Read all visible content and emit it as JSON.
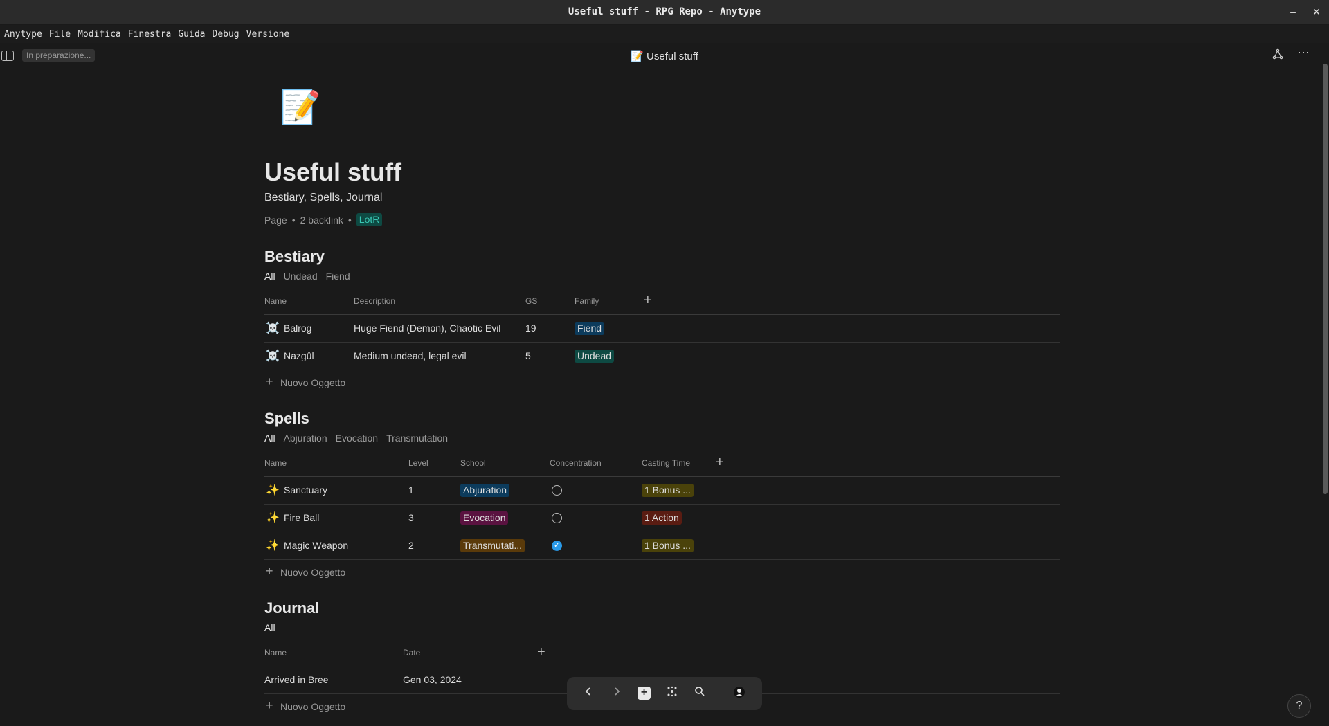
{
  "window": {
    "title": "Useful stuff - RPG Repo - Anytype"
  },
  "menu": [
    "Anytype",
    "File",
    "Modifica",
    "Finestra",
    "Guida",
    "Debug",
    "Versione"
  ],
  "header": {
    "sync_status": "In preparazione...",
    "title": "📝 Useful stuff"
  },
  "page": {
    "emoji": "📝",
    "title": "Useful stuff",
    "description": "Bestiary, Spells, Journal",
    "type": "Page",
    "backlinks": "2 backlink",
    "tag": "LotR"
  },
  "bestiary": {
    "title": "Bestiary",
    "views": [
      "All",
      "Undead",
      "Fiend"
    ],
    "columns": [
      "Name",
      "Description",
      "GS",
      "Family"
    ],
    "rows": [
      {
        "icon": "☠️",
        "name": "Balrog",
        "description": "Huge Fiend (Demon), Chaotic Evil",
        "gs": "19",
        "family": "Fiend"
      },
      {
        "icon": "☠️",
        "name": "Nazgûl",
        "description": "Medium undead, legal evil",
        "gs": "5",
        "family": "Undead"
      }
    ],
    "new_label": "Nuovo Oggetto"
  },
  "spells": {
    "title": "Spells",
    "views": [
      "All",
      "Abjuration",
      "Evocation",
      "Transmutation"
    ],
    "columns": [
      "Name",
      "Level",
      "School",
      "Concentration",
      "Casting Time"
    ],
    "rows": [
      {
        "icon": "✨",
        "name": "Sanctuary",
        "level": "1",
        "school": "Abjuration",
        "concentration": false,
        "casting_time": "1 Bonus ..."
      },
      {
        "icon": "✨",
        "name": "Fire Ball",
        "level": "3",
        "school": "Evocation",
        "concentration": false,
        "casting_time": "1 Action"
      },
      {
        "icon": "✨",
        "name": "Magic Weapon",
        "level": "2",
        "school": "Transmutati...",
        "concentration": true,
        "casting_time": "1 Bonus ..."
      }
    ],
    "new_label": "Nuovo Oggetto"
  },
  "journal": {
    "title": "Journal",
    "views": [
      "All"
    ],
    "columns": [
      "Name",
      "Date"
    ],
    "rows": [
      {
        "name": "Arrived in Bree",
        "date": "Gen 03, 2024"
      }
    ],
    "new_label": "Nuovo Oggetto"
  },
  "icons": {
    "nav": [
      "back-icon",
      "forward-icon",
      "plus-icon",
      "graph-icon",
      "search-icon",
      "profile-icon"
    ],
    "header_right": [
      "graph-icon",
      "more-icon"
    ],
    "help": "?"
  }
}
